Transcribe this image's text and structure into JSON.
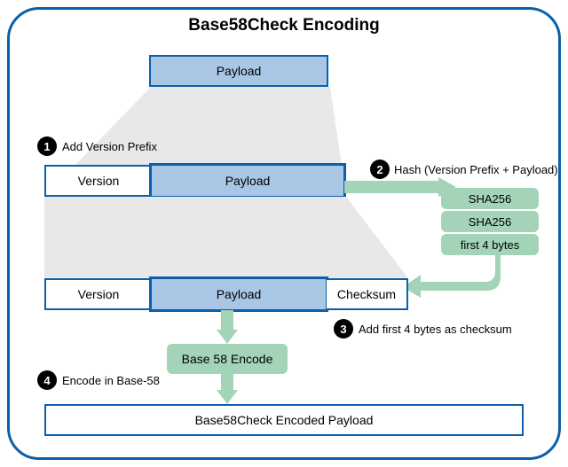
{
  "title": "Base58Check Encoding",
  "row1": {
    "payload": "Payload"
  },
  "step1": {
    "num": "1",
    "label": "Add Version Prefix"
  },
  "row2": {
    "version": "Version",
    "payload": "Payload"
  },
  "step2": {
    "num": "2",
    "label": "Hash (Version Prefix + Payload)"
  },
  "hash": {
    "sha256_1": "SHA256",
    "sha256_2": "SHA256",
    "first4": "first 4 bytes"
  },
  "row3": {
    "version": "Version",
    "payload": "Payload",
    "checksum": "Checksum"
  },
  "step3": {
    "num": "3",
    "label": "Add first 4 bytes as checksum"
  },
  "step4": {
    "num": "4",
    "label": "Encode in Base-58"
  },
  "encode": {
    "base58": "Base 58 Encode"
  },
  "result": {
    "payload": "Base58Check Encoded Payload"
  }
}
